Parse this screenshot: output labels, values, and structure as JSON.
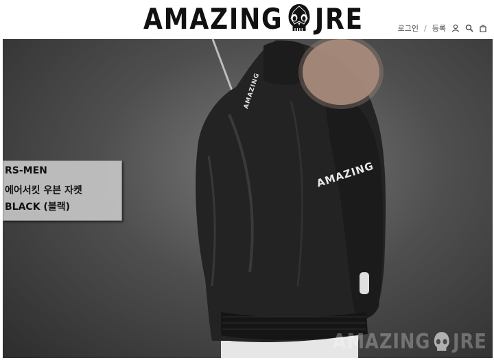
{
  "header": {
    "logo_left": "AMAZING",
    "logo_right": "JRE",
    "nav": {
      "login": "로그인",
      "separator": "/",
      "register": "등록"
    },
    "icons": [
      "user-icon",
      "search-icon",
      "cart-icon"
    ]
  },
  "hero": {
    "caption": {
      "line1": "RS-MEN",
      "line2": "에어서킷 우븐 자켓",
      "line3": "BLACK (블랙)"
    },
    "sleeve_text": "AMAZING",
    "collar_text": "AMAZING",
    "watermark_left": "AMAZING",
    "watermark_right": "JRE"
  },
  "colors": {
    "background": "#ffffff",
    "hero_bg": "#4f4f4f",
    "jacket": "#1f1f1f",
    "caption_bg": "#c4c4c4",
    "text": "#111111"
  }
}
